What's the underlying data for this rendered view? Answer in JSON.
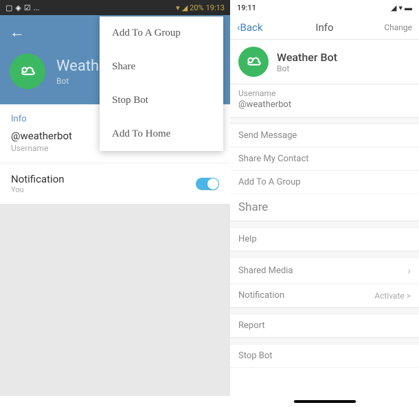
{
  "left": {
    "status": {
      "battery": "20%",
      "time": "19:13"
    },
    "title": "Weath",
    "subtitle": "Bot",
    "info_label": "Info",
    "username": "@weatherbot",
    "username_label": "Username",
    "notification_label": "Notification",
    "notification_sub": "You",
    "menu": {
      "add_group": "Add To A Group",
      "share": "Share",
      "stop_bot": "Stop Bot",
      "add_home": "Add To Home"
    }
  },
  "right": {
    "status": {
      "time": "19:11"
    },
    "nav": {
      "back": "Back",
      "title": "Info",
      "change": "Change"
    },
    "title": "Weather Bot",
    "subtitle": "Bot",
    "username_label": "Username",
    "username": "@weatherbot",
    "send_message": "Send Message",
    "share_contact": "Share My Contact",
    "add_group": "Add To A Group",
    "share": "Share",
    "help": "Help",
    "shared_media": "Shared Media",
    "notification": "Notification",
    "notification_val": "Activate >",
    "report": "Report",
    "stop_bot": "Stop Bot"
  }
}
